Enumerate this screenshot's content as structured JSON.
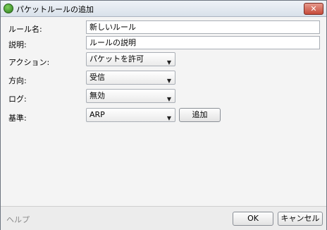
{
  "window": {
    "title": "パケットルールの追加",
    "close_label": "✕"
  },
  "form": {
    "rule_name": {
      "label": "ルール名:",
      "value": "新しいルール"
    },
    "description": {
      "label": "説明:",
      "value": "ルールの説明"
    },
    "action": {
      "label": "アクション:",
      "selected": "パケットを許可"
    },
    "direction": {
      "label": "方向:",
      "selected": "受信"
    },
    "log": {
      "label": "ログ:",
      "selected": "無効"
    },
    "criteria": {
      "label": "基準:",
      "selected": "ARP",
      "add_label": "追加"
    }
  },
  "footer": {
    "help_label": "ヘルプ",
    "ok_label": "OK",
    "cancel_label": "キャンセル"
  },
  "icons": {
    "dropdown": "chevron-down-icon",
    "app": "app-icon",
    "close": "close-icon"
  }
}
